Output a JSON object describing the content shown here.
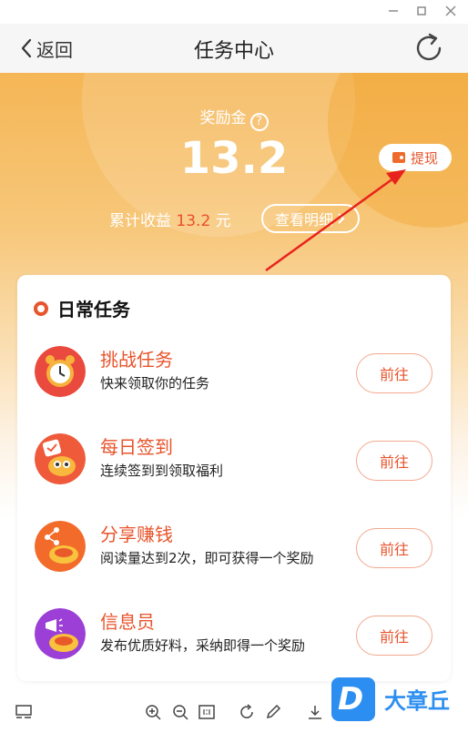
{
  "nav": {
    "back_label": "返回",
    "title": "任务中心"
  },
  "balance": {
    "label": "奖励金",
    "help_icon": "?",
    "value": "13.2",
    "withdraw_label": "提现"
  },
  "earnings": {
    "label": "累计收益",
    "amount": "13.2",
    "unit": "元",
    "detail_label": "查看明细"
  },
  "daily": {
    "title": "日常任务",
    "tasks": [
      {
        "name": "挑战任务",
        "desc": "快来领取你的任务",
        "action": "前往",
        "icon": "alarm-clock-icon"
      },
      {
        "name": "每日签到",
        "desc": "连续签到到领取福利",
        "action": "前往",
        "icon": "calendar-mascot-icon"
      },
      {
        "name": "分享赚钱",
        "desc": "阅读量达到2次，即可获得一个奖励",
        "action": "前往",
        "icon": "share-mascot-icon"
      },
      {
        "name": "信息员",
        "desc": "发布优质好料，采纳即得一个奖励",
        "action": "前往",
        "icon": "megaphone-mascot-icon"
      }
    ]
  },
  "brand": {
    "logo_letter": "D",
    "text": "大章丘"
  },
  "colors": {
    "accent": "#e8542c",
    "hero_top": "#f5b656",
    "brand_blue": "#2b8ef0"
  }
}
